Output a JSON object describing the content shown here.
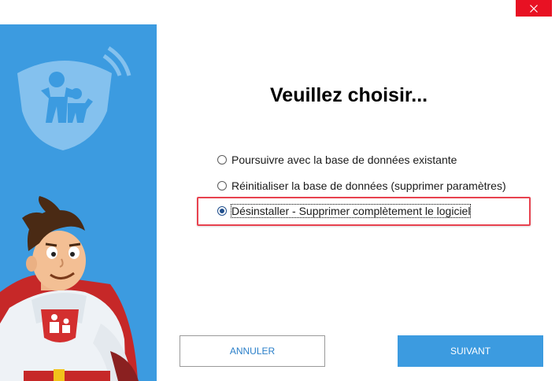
{
  "window": {
    "close_icon": "close-icon"
  },
  "sidebar": {
    "logo_icon": "family-shield-icon",
    "mascot": "superhero-mascot",
    "accent_color": "#3c9be0"
  },
  "dialog": {
    "title": "Veuillez choisir...",
    "options": [
      {
        "label": "Poursuivre avec la base de données existante",
        "selected": false
      },
      {
        "label": "Réinitialiser la base de données (supprimer paramètres)",
        "selected": false
      },
      {
        "label": "Désinstaller - Supprimer complètement le logiciel",
        "selected": true
      }
    ],
    "highlight_color": "#e8424f"
  },
  "buttons": {
    "cancel_label": "ANNULER",
    "next_label": "SUIVANT"
  }
}
